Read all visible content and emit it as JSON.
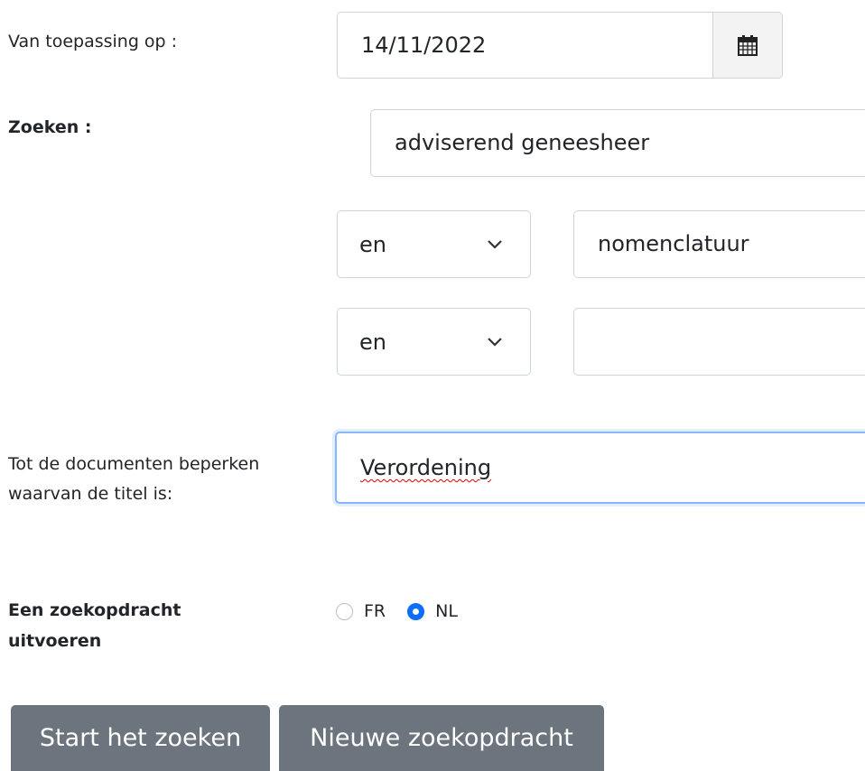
{
  "date_label": "Van toepassing op :",
  "date_value": "14/11/2022",
  "search_label": "Zoeken :",
  "search_value": "adviserend geneesheer",
  "rows": [
    {
      "operator": "en",
      "value": "nomenclatuur"
    },
    {
      "operator": "en",
      "value": ""
    }
  ],
  "title_label": "Tot de documenten beperken waarvan de titel is:",
  "title_value": "Verordening",
  "language_label": "Een zoekopdracht uitvoeren",
  "languages": [
    {
      "label": "FR",
      "checked": false
    },
    {
      "label": "NL",
      "checked": true
    }
  ],
  "buttons": {
    "start": "Start het zoeken",
    "new": "Nieuwe zoekopdracht"
  },
  "colors": {
    "button_bg": "#6c757d",
    "radio_on": "#0d6efd",
    "focus_border": "#86b7fe"
  },
  "icons": {
    "calendar": "calendar-icon",
    "chevron": "chevron-down-icon"
  }
}
